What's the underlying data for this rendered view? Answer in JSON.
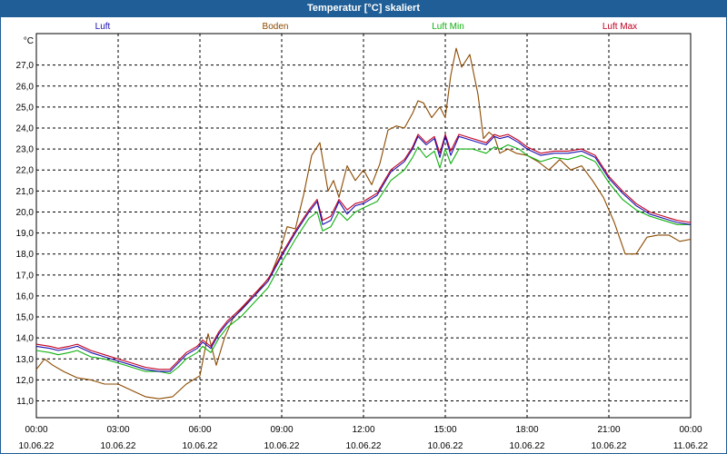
{
  "window": {
    "title": "Temperatur [°C] skaliert"
  },
  "chart_data": {
    "type": "line",
    "title": "Temperatur [°C] skaliert",
    "y_unit": "°C",
    "ylim": [
      10.2,
      28.5
    ],
    "yticks": [
      "11,0",
      "12,0",
      "13,0",
      "14,0",
      "15,0",
      "16,0",
      "17,0",
      "18,0",
      "19,0",
      "20,0",
      "21,0",
      "22,0",
      "23,0",
      "24,0",
      "25,0",
      "26,0",
      "27,0"
    ],
    "xlim": [
      0,
      24
    ],
    "xticks": [
      {
        "h": 0,
        "time": "00:00",
        "date": "10.06.22"
      },
      {
        "h": 3,
        "time": "03:00",
        "date": "10.06.22"
      },
      {
        "h": 6,
        "time": "06:00",
        "date": "10.06.22"
      },
      {
        "h": 9,
        "time": "09:00",
        "date": "10.06.22"
      },
      {
        "h": 12,
        "time": "12:00",
        "date": "10.06.22"
      },
      {
        "h": 15,
        "time": "15:00",
        "date": "10.06.22"
      },
      {
        "h": 18,
        "time": "18:00",
        "date": "10.06.22"
      },
      {
        "h": 21,
        "time": "21:00",
        "date": "10.06.22"
      },
      {
        "h": 24,
        "time": "00:00",
        "date": "11.06.22"
      }
    ],
    "grid": true,
    "series": [
      {
        "name": "Luft",
        "color": "#1a10b0",
        "x": [
          0,
          0.5,
          0.8,
          1.2,
          1.5,
          2,
          2.5,
          3,
          3.5,
          4,
          4.5,
          4.9,
          5.2,
          5.5,
          5.9,
          6.1,
          6.4,
          6.7,
          7,
          7.5,
          8,
          8.5,
          9,
          9.5,
          10,
          10.3,
          10.5,
          10.8,
          11.1,
          11.4,
          11.7,
          12,
          12.5,
          13,
          13.5,
          13.8,
          14,
          14.3,
          14.6,
          14.8,
          15,
          15.2,
          15.5,
          16,
          16.5,
          16.8,
          17,
          17.3,
          17.7,
          18,
          18.5,
          19,
          19.5,
          20,
          20.5,
          21,
          21.5,
          22,
          22.5,
          23,
          23.5,
          24
        ],
        "y": [
          13.6,
          13.5,
          13.4,
          13.5,
          13.6,
          13.3,
          13.1,
          12.9,
          12.7,
          12.5,
          12.4,
          12.4,
          12.8,
          13.2,
          13.5,
          13.8,
          13.5,
          14.2,
          14.7,
          15.3,
          16.0,
          16.7,
          17.9,
          19.0,
          20.0,
          20.5,
          19.4,
          19.6,
          20.5,
          19.9,
          20.3,
          20.4,
          20.8,
          21.9,
          22.4,
          23.0,
          23.6,
          23.2,
          23.5,
          22.6,
          23.6,
          22.7,
          23.6,
          23.4,
          23.2,
          23.6,
          23.5,
          23.6,
          23.3,
          23.0,
          22.7,
          22.8,
          22.8,
          22.9,
          22.6,
          21.6,
          20.9,
          20.3,
          19.9,
          19.7,
          19.5,
          19.4
        ]
      },
      {
        "name": "Boden",
        "color": "#8b4a00",
        "x": [
          0,
          0.3,
          0.6,
          1,
          1.5,
          2,
          2.5,
          3,
          3.5,
          4,
          4.5,
          5,
          5.5,
          6,
          6.3,
          6.6,
          6.9,
          7.2,
          7.6,
          8,
          8.3,
          8.6,
          8.9,
          9.2,
          9.5,
          9.8,
          10.1,
          10.4,
          10.7,
          10.9,
          11.1,
          11.4,
          11.7,
          12,
          12.3,
          12.6,
          12.9,
          13.2,
          13.5,
          13.8,
          14,
          14.2,
          14.5,
          14.8,
          15,
          15.2,
          15.4,
          15.6,
          15.9,
          16.2,
          16.4,
          16.6,
          16.8,
          17,
          17.3,
          17.6,
          18,
          18.4,
          18.8,
          19.2,
          19.6,
          20,
          20.4,
          20.8,
          21.2,
          21.6,
          22,
          22.4,
          22.8,
          23.2,
          23.6,
          24
        ],
        "y": [
          12.5,
          13.0,
          12.7,
          12.4,
          12.1,
          12.0,
          11.8,
          11.8,
          11.5,
          11.2,
          11.1,
          11.2,
          11.8,
          12.2,
          14.2,
          12.7,
          14.0,
          14.9,
          15.5,
          16.0,
          16.5,
          17.0,
          18.0,
          19.3,
          19.2,
          20.8,
          22.7,
          23.3,
          21.0,
          21.5,
          20.7,
          22.2,
          21.5,
          22.0,
          21.3,
          22.3,
          23.9,
          24.1,
          24.0,
          24.7,
          25.3,
          25.2,
          24.5,
          25.0,
          24.5,
          26.5,
          27.8,
          26.9,
          27.5,
          25.6,
          23.5,
          23.8,
          23.6,
          22.8,
          23.0,
          22.8,
          22.7,
          22.4,
          22.0,
          22.5,
          22.0,
          22.2,
          21.5,
          20.7,
          19.5,
          18.0,
          18.0,
          18.8,
          18.9,
          18.9,
          18.6,
          18.7
        ]
      },
      {
        "name": "Luft Min",
        "color": "#10b010",
        "x": [
          0,
          0.5,
          0.8,
          1.2,
          1.5,
          2,
          2.5,
          3,
          3.5,
          4,
          4.5,
          4.9,
          5.2,
          5.5,
          5.9,
          6.1,
          6.4,
          6.7,
          7,
          7.5,
          8,
          8.5,
          9,
          9.5,
          10,
          10.3,
          10.5,
          10.8,
          11.1,
          11.4,
          11.7,
          12,
          12.5,
          13,
          13.5,
          13.8,
          14,
          14.3,
          14.6,
          14.8,
          15,
          15.2,
          15.5,
          16,
          16.5,
          16.8,
          17,
          17.3,
          17.7,
          18,
          18.5,
          19,
          19.5,
          20,
          20.5,
          21,
          21.5,
          22,
          22.5,
          23,
          23.5,
          24
        ],
        "y": [
          13.4,
          13.3,
          13.2,
          13.3,
          13.4,
          13.1,
          13.0,
          12.8,
          12.6,
          12.4,
          12.4,
          12.3,
          12.6,
          13.0,
          13.3,
          13.6,
          13.3,
          14.0,
          14.5,
          15.0,
          15.7,
          16.4,
          17.6,
          18.7,
          19.7,
          20.0,
          19.1,
          19.3,
          20.0,
          19.6,
          20.0,
          20.2,
          20.5,
          21.5,
          22.0,
          22.6,
          23.1,
          22.6,
          22.9,
          22.1,
          23.0,
          22.3,
          23.0,
          23.0,
          22.8,
          23.1,
          23.0,
          23.2,
          23.0,
          22.7,
          22.4,
          22.6,
          22.5,
          22.7,
          22.4,
          21.4,
          20.6,
          20.1,
          19.8,
          19.6,
          19.4,
          19.4
        ]
      },
      {
        "name": "Luft Max",
        "color": "#c00020",
        "x": [
          0,
          0.5,
          0.8,
          1.2,
          1.5,
          2,
          2.5,
          3,
          3.5,
          4,
          4.5,
          4.9,
          5.2,
          5.5,
          5.9,
          6.1,
          6.4,
          6.7,
          7,
          7.5,
          8,
          8.5,
          9,
          9.5,
          10,
          10.3,
          10.5,
          10.8,
          11.1,
          11.4,
          11.7,
          12,
          12.5,
          13,
          13.5,
          13.8,
          14,
          14.3,
          14.6,
          14.8,
          15,
          15.2,
          15.5,
          16,
          16.5,
          16.8,
          17,
          17.3,
          17.7,
          18,
          18.5,
          19,
          19.5,
          20,
          20.5,
          21,
          21.5,
          22,
          22.5,
          23,
          23.5,
          24
        ],
        "y": [
          13.7,
          13.6,
          13.5,
          13.6,
          13.7,
          13.4,
          13.2,
          13.0,
          12.8,
          12.6,
          12.5,
          12.5,
          12.9,
          13.3,
          13.6,
          13.9,
          13.6,
          14.3,
          14.8,
          15.4,
          16.1,
          16.8,
          18.0,
          19.1,
          20.1,
          20.6,
          19.6,
          19.8,
          20.6,
          20.1,
          20.4,
          20.5,
          20.9,
          22.0,
          22.5,
          23.1,
          23.7,
          23.3,
          23.6,
          22.8,
          23.7,
          22.9,
          23.7,
          23.5,
          23.3,
          23.7,
          23.6,
          23.7,
          23.4,
          23.1,
          22.8,
          22.9,
          22.9,
          23.0,
          22.7,
          21.7,
          21.0,
          20.4,
          20.0,
          19.8,
          19.6,
          19.5
        ]
      }
    ]
  }
}
